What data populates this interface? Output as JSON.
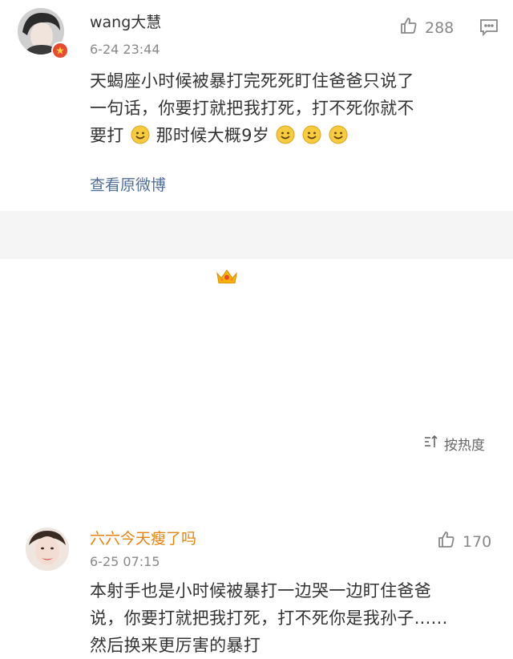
{
  "comments": [
    {
      "username": "wang大慧",
      "time": "6-24 23:44",
      "likes": "288",
      "text_line1": "天蝎座小时候被暴打完死死盯住爸爸只说了",
      "text_line2": "一句话，你要打就把我打死，打不死你就不",
      "text_line3a": "要打",
      "text_line3b": "那时候大概9岁",
      "view_original": "查看原微博"
    },
    {
      "username": "六六今天瘦了吗",
      "time": "6-25 07:15",
      "likes": "170",
      "text_line1": "本射手也是小时候被暴打一边哭一边盯住爸爸",
      "text_line2": "说，你要打就把我打死，打不死你是我孙子......",
      "text_line3": "然后换来更厉害的暴打"
    }
  ],
  "sort": {
    "label": "按热度"
  },
  "colors": {
    "link": "#506e9a",
    "vip_name": "#e8830e",
    "separator": "#f5f5f5"
  },
  "icons": [
    "thumbs-up-icon",
    "comment-icon",
    "smile-emoji-icon",
    "sort-icon",
    "crown-icon",
    "verified-badge-icon"
  ]
}
